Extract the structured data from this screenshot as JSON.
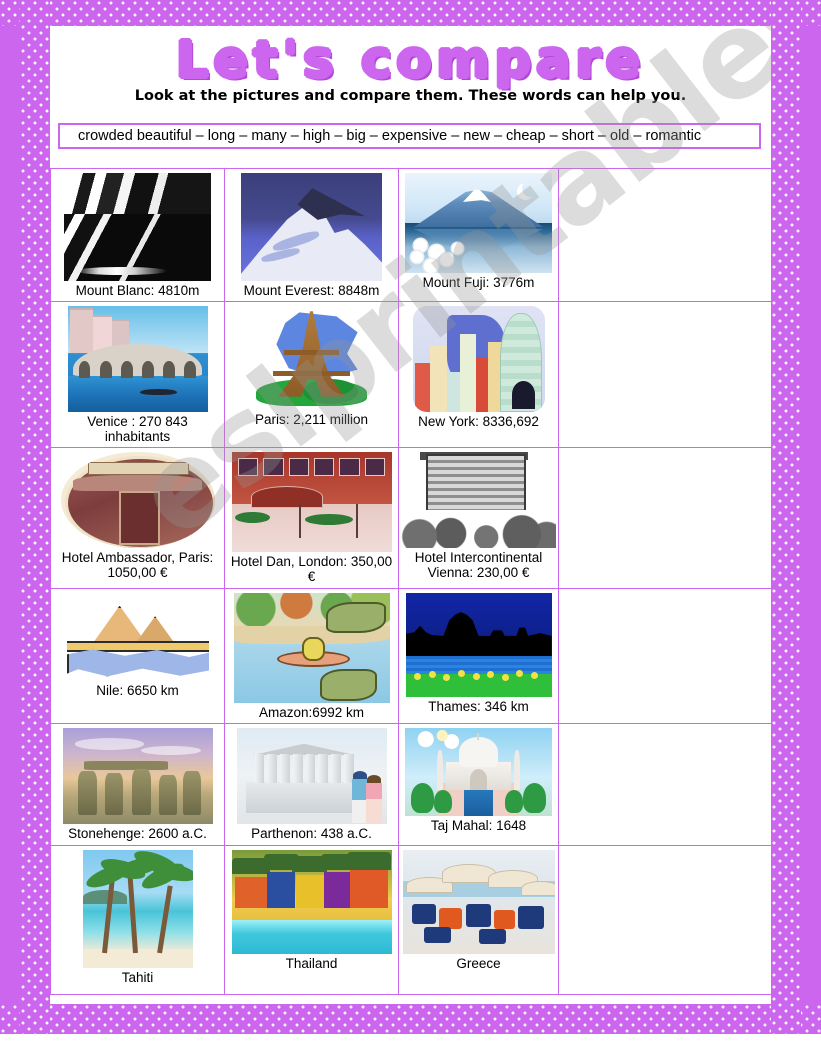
{
  "worksheet": {
    "title": "Let's compare",
    "instruction": "Look at the pictures and compare them. These words can help you.",
    "word_bank": "crowded beautiful – long – many – high – big – expensive – new – cheap – short – old – romantic",
    "watermark": "eslprintables.com",
    "accent_color": "#cc66ee",
    "text_color": "#000000"
  },
  "table": {
    "rows": [
      {
        "topic": "mountains",
        "cells": [
          {
            "caption": "Mount Blanc: 4810m",
            "image": "mount-blanc-photo"
          },
          {
            "caption": "Mount Everest: 8848m",
            "image": "mount-everest-illustration"
          },
          {
            "caption": "Mount Fuji: 3776m",
            "image": "mount-fuji-illustration"
          },
          {
            "caption": "",
            "image": ""
          }
        ]
      },
      {
        "topic": "cities",
        "cells": [
          {
            "caption": "Venice : 270 843 inhabitants",
            "image": "venice-rialto-bridge-photo"
          },
          {
            "caption": "Paris: 2,211 million",
            "image": "eiffel-tower-clipart"
          },
          {
            "caption": "New York: 8336,692",
            "image": "new-york-skyline-clipart"
          },
          {
            "caption": "",
            "image": ""
          }
        ]
      },
      {
        "topic": "hotels",
        "cells": [
          {
            "caption": "Hotel Ambassador, Paris: 1050,00 €",
            "image": "hotel-ambassador-engraving"
          },
          {
            "caption": "Hotel  Dan, London: 350,00 €",
            "image": "hotel-dan-london-illustration"
          },
          {
            "caption": "Hotel Intercontinental Vienna: 230,00 €",
            "image": "hotel-intercontinental-engraving"
          },
          {
            "caption": "",
            "image": ""
          }
        ]
      },
      {
        "topic": "rivers",
        "cells": [
          {
            "caption": "Nile: 6650 km",
            "image": "nile-pyramids-clipart"
          },
          {
            "caption": "Amazon:6992 km",
            "image": "amazon-kayak-crocodiles-cartoon"
          },
          {
            "caption": "Thames: 346 km",
            "image": "thames-london-silhouette"
          },
          {
            "caption": "",
            "image": ""
          }
        ]
      },
      {
        "topic": "monuments",
        "cells": [
          {
            "caption": "Stonehenge: 2600 a.C.",
            "image": "stonehenge-photo"
          },
          {
            "caption": "Parthenon: 438 a.C.",
            "image": "parthenon-with-tourists"
          },
          {
            "caption": "Taj Mahal: 1648",
            "image": "taj-mahal-illustration"
          },
          {
            "caption": "",
            "image": ""
          }
        ]
      },
      {
        "topic": "beaches",
        "cells": [
          {
            "caption": "Tahiti",
            "image": "tahiti-palm-beach"
          },
          {
            "caption": "Thailand",
            "image": "thailand-beach-huts"
          },
          {
            "caption": "Greece",
            "image": "greece-beach-umbrellas"
          },
          {
            "caption": "",
            "image": ""
          }
        ]
      }
    ]
  }
}
